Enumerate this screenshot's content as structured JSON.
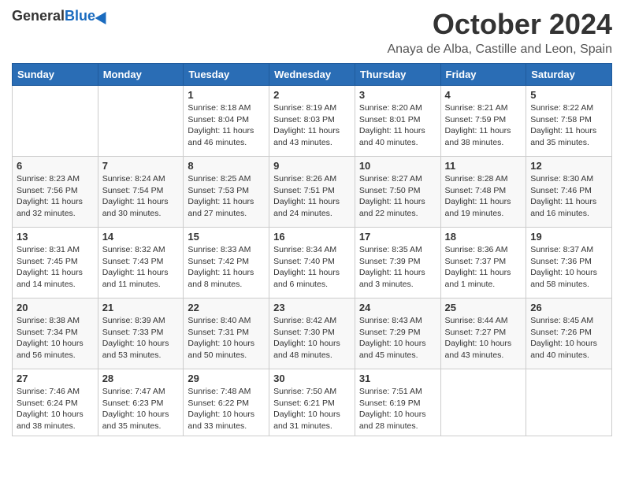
{
  "header": {
    "logo_general": "General",
    "logo_blue": "Blue",
    "month_title": "October 2024",
    "location": "Anaya de Alba, Castille and Leon, Spain"
  },
  "weekdays": [
    "Sunday",
    "Monday",
    "Tuesday",
    "Wednesday",
    "Thursday",
    "Friday",
    "Saturday"
  ],
  "weeks": [
    [
      {
        "day": "",
        "info": ""
      },
      {
        "day": "",
        "info": ""
      },
      {
        "day": "1",
        "info": "Sunrise: 8:18 AM\nSunset: 8:04 PM\nDaylight: 11 hours and 46 minutes."
      },
      {
        "day": "2",
        "info": "Sunrise: 8:19 AM\nSunset: 8:03 PM\nDaylight: 11 hours and 43 minutes."
      },
      {
        "day": "3",
        "info": "Sunrise: 8:20 AM\nSunset: 8:01 PM\nDaylight: 11 hours and 40 minutes."
      },
      {
        "day": "4",
        "info": "Sunrise: 8:21 AM\nSunset: 7:59 PM\nDaylight: 11 hours and 38 minutes."
      },
      {
        "day": "5",
        "info": "Sunrise: 8:22 AM\nSunset: 7:58 PM\nDaylight: 11 hours and 35 minutes."
      }
    ],
    [
      {
        "day": "6",
        "info": "Sunrise: 8:23 AM\nSunset: 7:56 PM\nDaylight: 11 hours and 32 minutes."
      },
      {
        "day": "7",
        "info": "Sunrise: 8:24 AM\nSunset: 7:54 PM\nDaylight: 11 hours and 30 minutes."
      },
      {
        "day": "8",
        "info": "Sunrise: 8:25 AM\nSunset: 7:53 PM\nDaylight: 11 hours and 27 minutes."
      },
      {
        "day": "9",
        "info": "Sunrise: 8:26 AM\nSunset: 7:51 PM\nDaylight: 11 hours and 24 minutes."
      },
      {
        "day": "10",
        "info": "Sunrise: 8:27 AM\nSunset: 7:50 PM\nDaylight: 11 hours and 22 minutes."
      },
      {
        "day": "11",
        "info": "Sunrise: 8:28 AM\nSunset: 7:48 PM\nDaylight: 11 hours and 19 minutes."
      },
      {
        "day": "12",
        "info": "Sunrise: 8:30 AM\nSunset: 7:46 PM\nDaylight: 11 hours and 16 minutes."
      }
    ],
    [
      {
        "day": "13",
        "info": "Sunrise: 8:31 AM\nSunset: 7:45 PM\nDaylight: 11 hours and 14 minutes."
      },
      {
        "day": "14",
        "info": "Sunrise: 8:32 AM\nSunset: 7:43 PM\nDaylight: 11 hours and 11 minutes."
      },
      {
        "day": "15",
        "info": "Sunrise: 8:33 AM\nSunset: 7:42 PM\nDaylight: 11 hours and 8 minutes."
      },
      {
        "day": "16",
        "info": "Sunrise: 8:34 AM\nSunset: 7:40 PM\nDaylight: 11 hours and 6 minutes."
      },
      {
        "day": "17",
        "info": "Sunrise: 8:35 AM\nSunset: 7:39 PM\nDaylight: 11 hours and 3 minutes."
      },
      {
        "day": "18",
        "info": "Sunrise: 8:36 AM\nSunset: 7:37 PM\nDaylight: 11 hours and 1 minute."
      },
      {
        "day": "19",
        "info": "Sunrise: 8:37 AM\nSunset: 7:36 PM\nDaylight: 10 hours and 58 minutes."
      }
    ],
    [
      {
        "day": "20",
        "info": "Sunrise: 8:38 AM\nSunset: 7:34 PM\nDaylight: 10 hours and 56 minutes."
      },
      {
        "day": "21",
        "info": "Sunrise: 8:39 AM\nSunset: 7:33 PM\nDaylight: 10 hours and 53 minutes."
      },
      {
        "day": "22",
        "info": "Sunrise: 8:40 AM\nSunset: 7:31 PM\nDaylight: 10 hours and 50 minutes."
      },
      {
        "day": "23",
        "info": "Sunrise: 8:42 AM\nSunset: 7:30 PM\nDaylight: 10 hours and 48 minutes."
      },
      {
        "day": "24",
        "info": "Sunrise: 8:43 AM\nSunset: 7:29 PM\nDaylight: 10 hours and 45 minutes."
      },
      {
        "day": "25",
        "info": "Sunrise: 8:44 AM\nSunset: 7:27 PM\nDaylight: 10 hours and 43 minutes."
      },
      {
        "day": "26",
        "info": "Sunrise: 8:45 AM\nSunset: 7:26 PM\nDaylight: 10 hours and 40 minutes."
      }
    ],
    [
      {
        "day": "27",
        "info": "Sunrise: 7:46 AM\nSunset: 6:24 PM\nDaylight: 10 hours and 38 minutes."
      },
      {
        "day": "28",
        "info": "Sunrise: 7:47 AM\nSunset: 6:23 PM\nDaylight: 10 hours and 35 minutes."
      },
      {
        "day": "29",
        "info": "Sunrise: 7:48 AM\nSunset: 6:22 PM\nDaylight: 10 hours and 33 minutes."
      },
      {
        "day": "30",
        "info": "Sunrise: 7:50 AM\nSunset: 6:21 PM\nDaylight: 10 hours and 31 minutes."
      },
      {
        "day": "31",
        "info": "Sunrise: 7:51 AM\nSunset: 6:19 PM\nDaylight: 10 hours and 28 minutes."
      },
      {
        "day": "",
        "info": ""
      },
      {
        "day": "",
        "info": ""
      }
    ]
  ]
}
